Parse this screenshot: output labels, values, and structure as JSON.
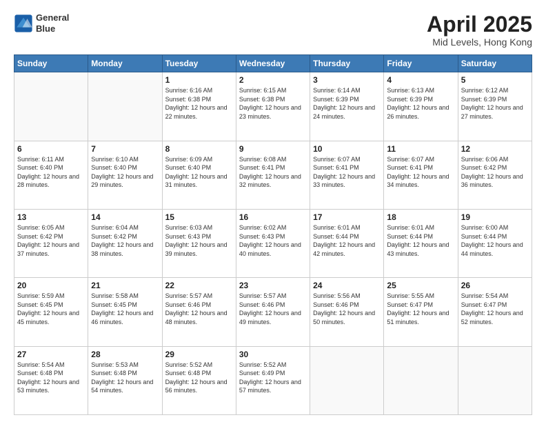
{
  "logo": {
    "line1": "General",
    "line2": "Blue"
  },
  "title": "April 2025",
  "subtitle": "Mid Levels, Hong Kong",
  "days_header": [
    "Sunday",
    "Monday",
    "Tuesday",
    "Wednesday",
    "Thursday",
    "Friday",
    "Saturday"
  ],
  "weeks": [
    [
      {
        "day": "",
        "info": ""
      },
      {
        "day": "",
        "info": ""
      },
      {
        "day": "1",
        "info": "Sunrise: 6:16 AM\nSunset: 6:38 PM\nDaylight: 12 hours and 22 minutes."
      },
      {
        "day": "2",
        "info": "Sunrise: 6:15 AM\nSunset: 6:38 PM\nDaylight: 12 hours and 23 minutes."
      },
      {
        "day": "3",
        "info": "Sunrise: 6:14 AM\nSunset: 6:39 PM\nDaylight: 12 hours and 24 minutes."
      },
      {
        "day": "4",
        "info": "Sunrise: 6:13 AM\nSunset: 6:39 PM\nDaylight: 12 hours and 26 minutes."
      },
      {
        "day": "5",
        "info": "Sunrise: 6:12 AM\nSunset: 6:39 PM\nDaylight: 12 hours and 27 minutes."
      }
    ],
    [
      {
        "day": "6",
        "info": "Sunrise: 6:11 AM\nSunset: 6:40 PM\nDaylight: 12 hours and 28 minutes."
      },
      {
        "day": "7",
        "info": "Sunrise: 6:10 AM\nSunset: 6:40 PM\nDaylight: 12 hours and 29 minutes."
      },
      {
        "day": "8",
        "info": "Sunrise: 6:09 AM\nSunset: 6:40 PM\nDaylight: 12 hours and 31 minutes."
      },
      {
        "day": "9",
        "info": "Sunrise: 6:08 AM\nSunset: 6:41 PM\nDaylight: 12 hours and 32 minutes."
      },
      {
        "day": "10",
        "info": "Sunrise: 6:07 AM\nSunset: 6:41 PM\nDaylight: 12 hours and 33 minutes."
      },
      {
        "day": "11",
        "info": "Sunrise: 6:07 AM\nSunset: 6:41 PM\nDaylight: 12 hours and 34 minutes."
      },
      {
        "day": "12",
        "info": "Sunrise: 6:06 AM\nSunset: 6:42 PM\nDaylight: 12 hours and 36 minutes."
      }
    ],
    [
      {
        "day": "13",
        "info": "Sunrise: 6:05 AM\nSunset: 6:42 PM\nDaylight: 12 hours and 37 minutes."
      },
      {
        "day": "14",
        "info": "Sunrise: 6:04 AM\nSunset: 6:42 PM\nDaylight: 12 hours and 38 minutes."
      },
      {
        "day": "15",
        "info": "Sunrise: 6:03 AM\nSunset: 6:43 PM\nDaylight: 12 hours and 39 minutes."
      },
      {
        "day": "16",
        "info": "Sunrise: 6:02 AM\nSunset: 6:43 PM\nDaylight: 12 hours and 40 minutes."
      },
      {
        "day": "17",
        "info": "Sunrise: 6:01 AM\nSunset: 6:44 PM\nDaylight: 12 hours and 42 minutes."
      },
      {
        "day": "18",
        "info": "Sunrise: 6:01 AM\nSunset: 6:44 PM\nDaylight: 12 hours and 43 minutes."
      },
      {
        "day": "19",
        "info": "Sunrise: 6:00 AM\nSunset: 6:44 PM\nDaylight: 12 hours and 44 minutes."
      }
    ],
    [
      {
        "day": "20",
        "info": "Sunrise: 5:59 AM\nSunset: 6:45 PM\nDaylight: 12 hours and 45 minutes."
      },
      {
        "day": "21",
        "info": "Sunrise: 5:58 AM\nSunset: 6:45 PM\nDaylight: 12 hours and 46 minutes."
      },
      {
        "day": "22",
        "info": "Sunrise: 5:57 AM\nSunset: 6:46 PM\nDaylight: 12 hours and 48 minutes."
      },
      {
        "day": "23",
        "info": "Sunrise: 5:57 AM\nSunset: 6:46 PM\nDaylight: 12 hours and 49 minutes."
      },
      {
        "day": "24",
        "info": "Sunrise: 5:56 AM\nSunset: 6:46 PM\nDaylight: 12 hours and 50 minutes."
      },
      {
        "day": "25",
        "info": "Sunrise: 5:55 AM\nSunset: 6:47 PM\nDaylight: 12 hours and 51 minutes."
      },
      {
        "day": "26",
        "info": "Sunrise: 5:54 AM\nSunset: 6:47 PM\nDaylight: 12 hours and 52 minutes."
      }
    ],
    [
      {
        "day": "27",
        "info": "Sunrise: 5:54 AM\nSunset: 6:48 PM\nDaylight: 12 hours and 53 minutes."
      },
      {
        "day": "28",
        "info": "Sunrise: 5:53 AM\nSunset: 6:48 PM\nDaylight: 12 hours and 54 minutes."
      },
      {
        "day": "29",
        "info": "Sunrise: 5:52 AM\nSunset: 6:48 PM\nDaylight: 12 hours and 56 minutes."
      },
      {
        "day": "30",
        "info": "Sunrise: 5:52 AM\nSunset: 6:49 PM\nDaylight: 12 hours and 57 minutes."
      },
      {
        "day": "",
        "info": ""
      },
      {
        "day": "",
        "info": ""
      },
      {
        "day": "",
        "info": ""
      }
    ]
  ]
}
